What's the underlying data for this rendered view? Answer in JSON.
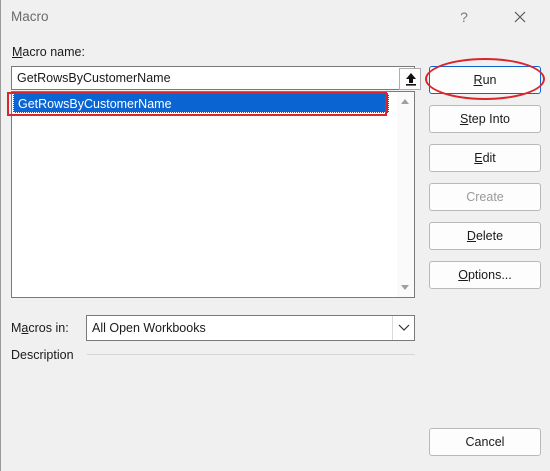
{
  "window": {
    "title": "Macro",
    "help_label": "?",
    "close_icon": "close-icon"
  },
  "macro_name": {
    "label_prefix": "M",
    "label_rest": "acro name:",
    "value": "GetRowsByCustomerName",
    "ref_icon": "upload-arrow-icon"
  },
  "macro_list": {
    "items": [
      "GetRowsByCustomerName"
    ],
    "selected_index": 0
  },
  "buttons": {
    "run": {
      "accel": "R",
      "rest": "un"
    },
    "step_into": {
      "accel": "S",
      "rest": "tep Into"
    },
    "edit": {
      "accel": "E",
      "rest": "dit"
    },
    "create": {
      "pre": "Create",
      "disabled": true
    },
    "delete": {
      "accel": "D",
      "rest": "elete"
    },
    "options": {
      "accel": "O",
      "rest": "ptions..."
    },
    "cancel": "Cancel"
  },
  "macros_in": {
    "label_pre": "M",
    "label_mid": "a",
    "label_rest": "cros in:",
    "value": "All Open Workbooks"
  },
  "description": {
    "label": "Description"
  },
  "colors": {
    "selection": "#0a64d2",
    "annotation": "#d9252b"
  }
}
